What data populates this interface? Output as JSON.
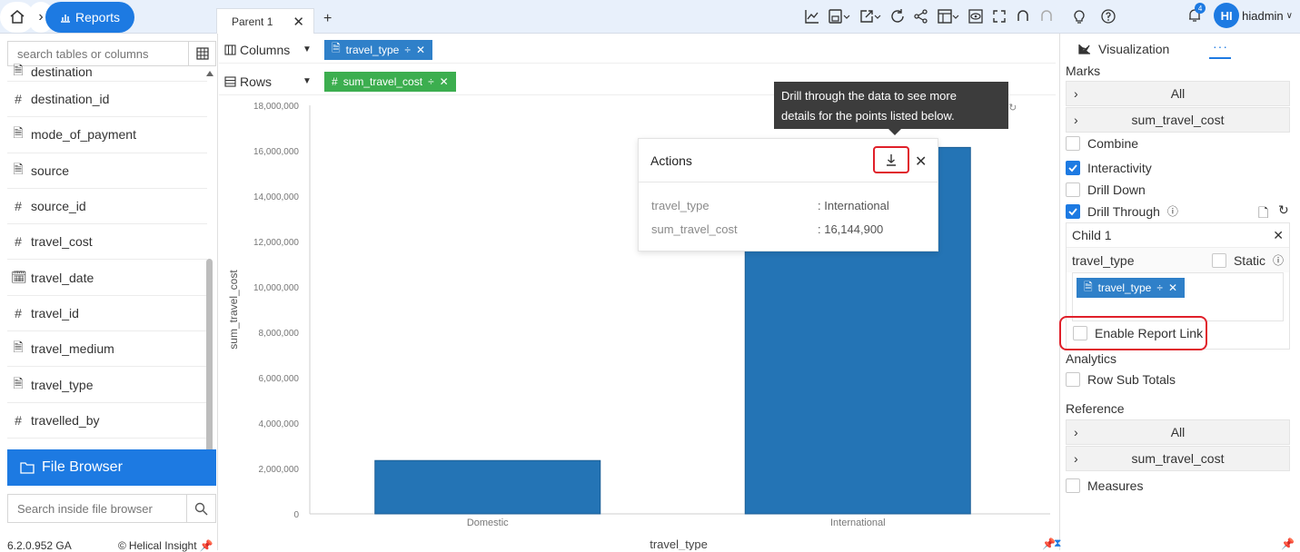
{
  "topbar": {
    "breadcrumb_reports": "Reports",
    "tab_label": "Parent 1",
    "user_initials": "HI",
    "user_name": "hiadmin",
    "notif_count": "4"
  },
  "left": {
    "search_placeholder": "search tables or columns",
    "fields": [
      {
        "name": "destination",
        "type": "text"
      },
      {
        "name": "destination_id",
        "type": "number"
      },
      {
        "name": "mode_of_payment",
        "type": "text"
      },
      {
        "name": "source",
        "type": "text"
      },
      {
        "name": "source_id",
        "type": "number"
      },
      {
        "name": "travel_cost",
        "type": "number"
      },
      {
        "name": "travel_date",
        "type": "date"
      },
      {
        "name": "travel_id",
        "type": "number"
      },
      {
        "name": "travel_medium",
        "type": "text"
      },
      {
        "name": "travel_type",
        "type": "text"
      },
      {
        "name": "travelled_by",
        "type": "number"
      }
    ],
    "file_browser": "File Browser",
    "fb_search_placeholder": "Search inside file browser",
    "version": "6.2.0.952 GA",
    "brand": "Helical Insight"
  },
  "shelves": {
    "columns_label": "Columns",
    "columns_pill": "travel_type",
    "rows_label": "Rows",
    "rows_pill": "sum_travel_cost"
  },
  "tooltip": {
    "line1": "Drill through the data to see more",
    "line2": "details for the points listed below."
  },
  "actions": {
    "title": "Actions",
    "rows": [
      {
        "key": "travel_type",
        "value": ": International"
      },
      {
        "key": "sum_travel_cost",
        "value": ": 16,144,900"
      }
    ]
  },
  "right": {
    "viz_tab": "Visualization",
    "more_tab": "···",
    "marks": "Marks",
    "acc_all": "All",
    "acc_sum": "sum_travel_cost",
    "combine": "Combine",
    "interactivity": "Interactivity",
    "drill_down": "Drill Down",
    "drill_through": "Drill Through",
    "child": "Child 1",
    "child_field": "travel_type",
    "static": "Static",
    "child_pill": "travel_type",
    "enable_report_link": "Enable Report Link",
    "analytics": "Analytics",
    "row_sub_totals": "Row Sub Totals",
    "reference": "Reference",
    "ref_all": "All",
    "ref_sum": "sum_travel_cost",
    "measures": "Measures"
  },
  "chart_data": {
    "type": "bar",
    "categories": [
      "Domestic",
      "International"
    ],
    "series": [
      {
        "values": [
          2350000,
          16144900
        ]
      }
    ],
    "xlabel": "travel_type",
    "ylabel": "sum_travel_cost",
    "ylim": [
      0,
      18000000
    ],
    "yticks": [
      "0",
      "2,000,000",
      "4,000,000",
      "6,000,000",
      "8,000,000",
      "10,000,000",
      "12,000,000",
      "14,000,000",
      "16,000,000",
      "18,000,000"
    ],
    "color": "#2474b5"
  }
}
